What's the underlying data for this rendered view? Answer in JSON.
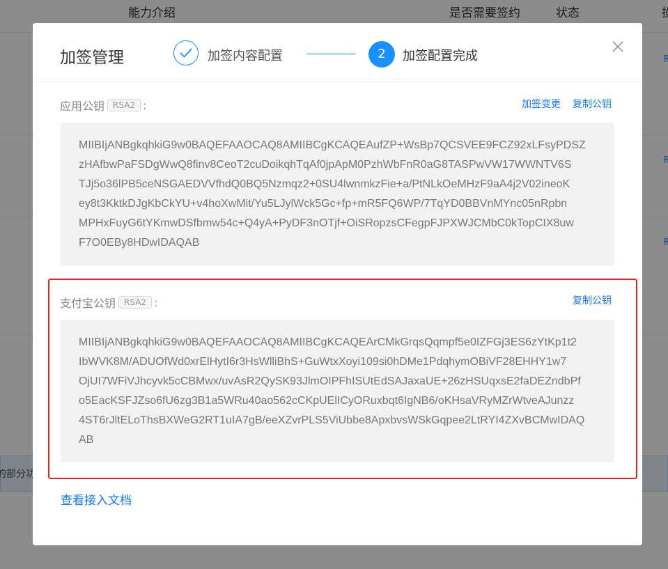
{
  "background": {
    "columns": [
      "能力介绍",
      "是否需要签约",
      "状态",
      "操"
    ],
    "info_text": "的部分功"
  },
  "modal": {
    "title": "加签管理",
    "steps": [
      {
        "label": "加签内容配置",
        "status": "done"
      },
      {
        "number": "2",
        "label": "加签配置完成",
        "status": "active"
      }
    ],
    "close_symbol": "✕",
    "app_public_key": {
      "label": "应用公钥",
      "badge": "RSA2",
      "colon": ":",
      "actions": [
        "加签变更",
        "复制公钥"
      ],
      "lines": [
        "MIIBIjANBgkqhkiG9w0BAQEFAAOCAQ8AMIIBCgKCAQEAufZP+WsBp7QCSVEE9FCZ92xLFsyPDSZ",
        "zHAfbwPaFSDgWwQ8finv8CeoT2cuDoikqhTqAf0jpApM0PzhWbFnR0aG8TASPwVW17WWNTV6S",
        "TJj5o36lPB5ceNSGAEDVVfhdQ0BQ5Nzmqz2+0SU4lwnmkzFie+a/PtNLkOeMHzF9aA4j2V02ineoK",
        "ey8t3KktkDJgKbCkYU+v4hoXwMit/Yu5LJylWck5Gc+fp+mR5FQ6WP/7TqYD0BBVnMYnc05nRpbn",
        "MPHxFuyG6tYKmwDSfbmw54c+Q4yA+PyDF3nOTjf+OiSRopzsCFegpFJPXWJCMbC0kTopCIX8uw",
        "F7O0EBy8HDwIDAQAB"
      ]
    },
    "alipay_public_key": {
      "label": "支付宝公钥",
      "badge": "RSA2",
      "colon": ":",
      "actions": [
        "复制公钥"
      ],
      "lines": [
        "MIIBIjANBgkqhkiG9w0BAQEFAAOCAQ8AMIIBCgKCAQEArCMkGrqsQqmpf5e0IZFGj3ES6zYtKp1t2",
        "IbWVK8M/ADUOfWd0xrElHytI6r3HsWlliBhS+GuWtxXoyi109si0hDMe1PdqhymOBiVF28EHHY1w7",
        "OjUI7WFiVJhcyvk5cCBMwx/uvAsR2QySK93JlmOIPFhISUtEdSAJaxaUE+26zHSUqxsE2faDEZndbPf",
        "o5EacKSFJZso6fU6zg3B1a5WRu40ao562cCKpUElICyORuxbqt6IgNB6/oKHsaVRyMZrWtveAJunzz",
        "4ST6rJltELoThsBXWeG2RT1uIA7gB/eeXZvrPLS5ViUbbe8ApxbvsWSkGqpee2LtRYI4ZXvBCMwIDAQ",
        "AB"
      ]
    },
    "doc_link": "查看接入文档"
  },
  "colors": {
    "accent": "#1890ff",
    "highlight": "#e8211a"
  },
  "icons": {
    "step1": "check-icon",
    "close": "close-icon"
  }
}
